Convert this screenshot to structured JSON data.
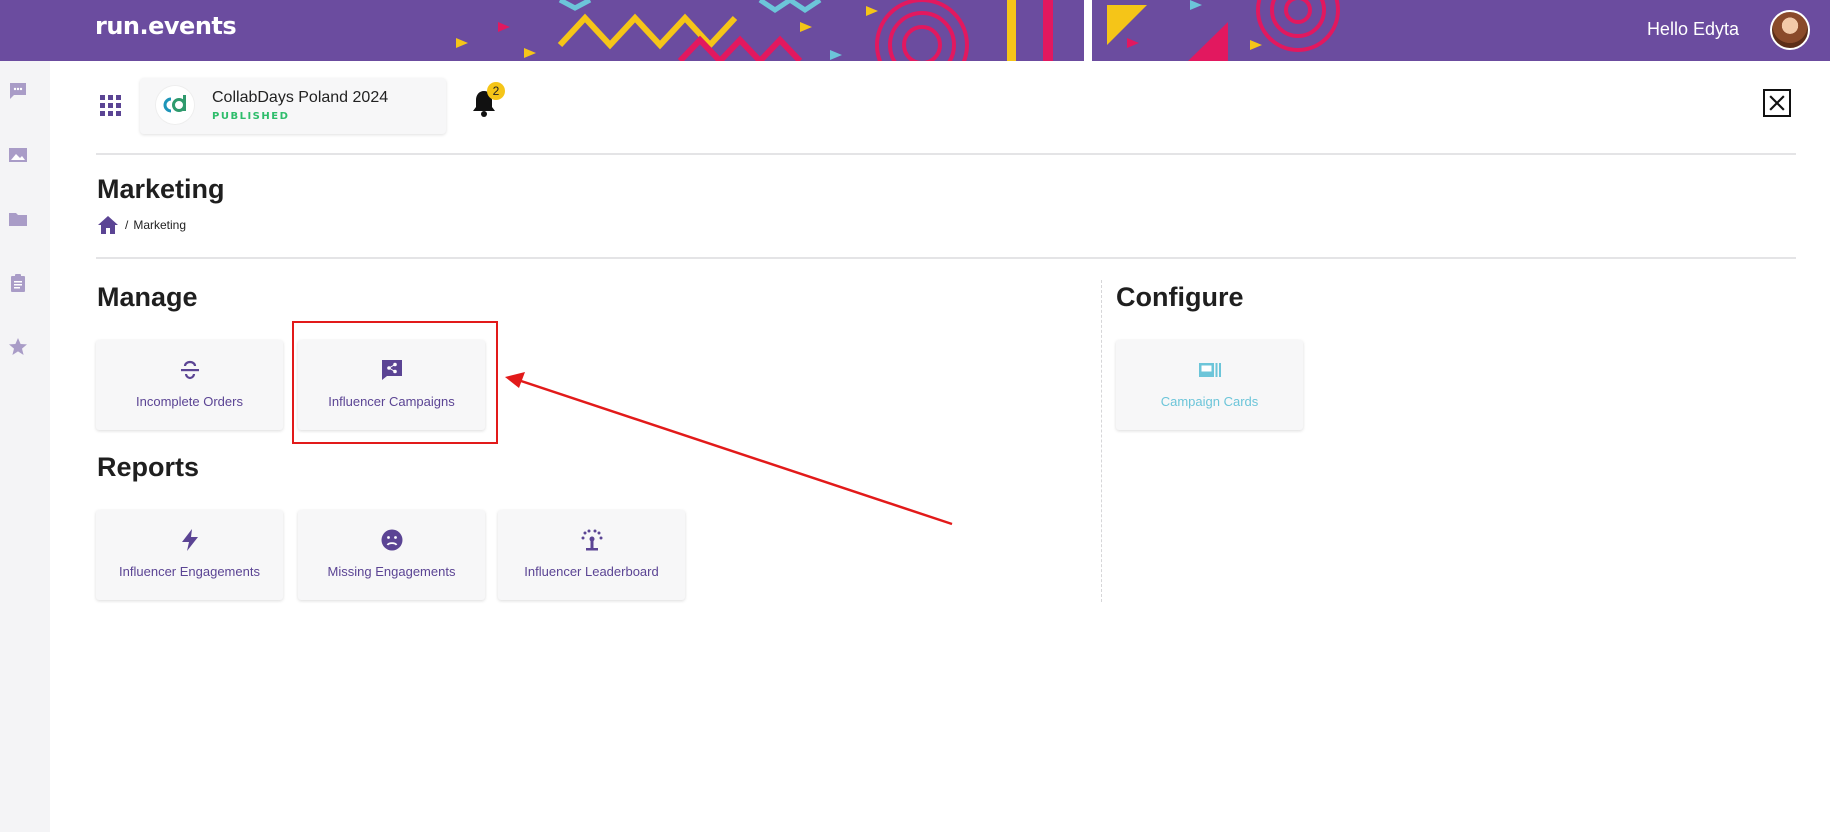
{
  "header": {
    "logo_text": "run.events",
    "greeting": "Hello Edyta",
    "background_color": "#6b4c9f"
  },
  "sidebar": {
    "items": [
      {
        "icon": "chat-icon"
      },
      {
        "icon": "image-icon"
      },
      {
        "icon": "folder-icon"
      },
      {
        "icon": "clipboard-icon"
      },
      {
        "icon": "star-icon"
      }
    ]
  },
  "event": {
    "logo_text": "cd",
    "name": "CollabDays Poland 2024",
    "status": "PUBLISHED",
    "status_color": "#2ebd6b"
  },
  "notifications": {
    "count": "2"
  },
  "page": {
    "title": "Marketing",
    "breadcrumb_sep": "/",
    "breadcrumb_current": "Marketing"
  },
  "sections": {
    "manage": {
      "title": "Manage",
      "tiles": [
        {
          "label": "Incomplete Orders",
          "icon": "strikethrough-icon"
        },
        {
          "label": "Influencer Campaigns",
          "icon": "share-chat-icon"
        }
      ]
    },
    "reports": {
      "title": "Reports",
      "tiles": [
        {
          "label": "Influencer Engagements",
          "icon": "lightning-icon"
        },
        {
          "label": "Missing Engagements",
          "icon": "sad-face-icon"
        },
        {
          "label": "Influencer Leaderboard",
          "icon": "fountain-icon"
        }
      ]
    },
    "configure": {
      "title": "Configure",
      "tiles": [
        {
          "label": "Campaign Cards",
          "icon": "cards-icon"
        }
      ]
    }
  },
  "colors": {
    "accent": "#5b4494",
    "configure_tile": "#6cc5d9",
    "annotation": "#e21a1a"
  }
}
